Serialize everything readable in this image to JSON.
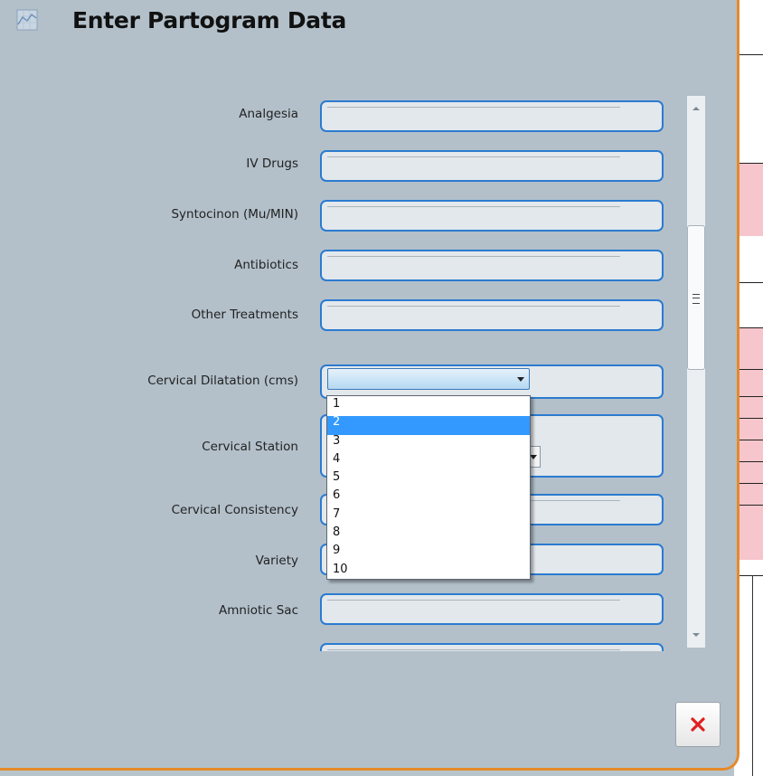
{
  "dialog": {
    "title": "Enter Partogram Data",
    "title_icon": "chart-icon",
    "accent_color": "#e58a2a",
    "field_border_color": "#2b7bd0"
  },
  "fields": [
    {
      "label": "Analgesia",
      "value": ""
    },
    {
      "label": "IV Drugs",
      "value": ""
    },
    {
      "label": "Syntocinon (Mu/MIN)",
      "value": ""
    },
    {
      "label": "Antibiotics",
      "value": ""
    },
    {
      "label": "Other Treatments",
      "value": ""
    },
    {
      "label": "Cervical Dilatation (cms)",
      "value": ""
    },
    {
      "label": "Cervical Station",
      "value": ""
    },
    {
      "label": "Cervical Consistency",
      "value": ""
    },
    {
      "label": "Variety",
      "value": ""
    },
    {
      "label": "Amniotic Sac",
      "value": ""
    }
  ],
  "dropdown": {
    "options": [
      "1",
      "2",
      "3",
      "4",
      "5",
      "6",
      "7",
      "8",
      "9",
      "10"
    ],
    "highlighted": "2",
    "highlight_color": "#3399ff"
  },
  "close_button": {
    "icon": "close-icon",
    "icon_color": "#e02020"
  }
}
